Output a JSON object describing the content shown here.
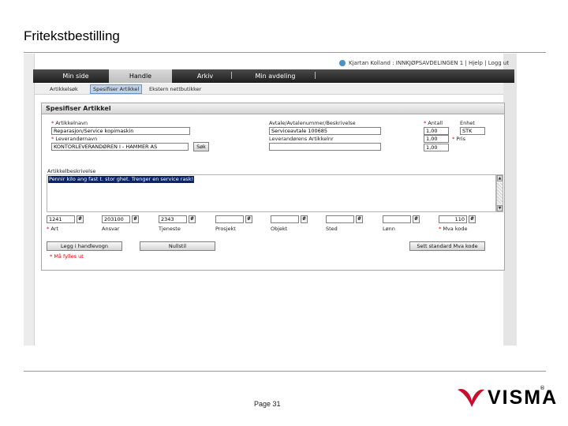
{
  "slide": {
    "title": "Fritekstbestilling",
    "page": "Page 31",
    "brand": "VISMA",
    "brand_mark": "®"
  },
  "app": {
    "userbar": "Kjartan Kolland : INNKJØPSAVDELINGEN 1 | Hjelp | Logg ut",
    "nav": {
      "tabs": [
        {
          "label": "Min side",
          "active": false
        },
        {
          "label": "Handle",
          "active": true
        },
        {
          "label": "Arkiv",
          "active": false
        },
        {
          "label": "Min avdeling",
          "active": false
        }
      ],
      "separator": "|"
    },
    "subnav": {
      "items": [
        {
          "label": "Artikkelsøk",
          "active": false
        },
        {
          "label": "Spesifiser Artikkel",
          "active": true
        },
        {
          "label": "Ekstern nettbutikker",
          "active": false
        }
      ]
    }
  },
  "form": {
    "title": "Spesifiser Artikkel",
    "required_mark": "*",
    "article_name": {
      "label": "Artikkelnavn",
      "value": "Reparasjon/Service kopimaskin"
    },
    "supplier_name": {
      "label": "Leverandørnavn",
      "value": "KONTORLEVERANDØREN I - HAMMER AS",
      "search_button": "Søk"
    },
    "agreement": {
      "label": "Avtale/Avtalenummer/Beskrivelse",
      "value": "Serviceavtale 100685"
    },
    "supplier_article_no": {
      "label": "Leverandørens Artikkelnr",
      "value": ""
    },
    "quantity": {
      "label": "Antall",
      "value": "1,00"
    },
    "unit": {
      "label": "Enhet",
      "value": "STK"
    },
    "price": {
      "label": "Pris",
      "value": "1,00"
    },
    "extra_field": {
      "value": "1,00"
    },
    "description": {
      "label": "Artikkelbeskrivelse",
      "value": "Pennir kilo ang fast t. stor ghet. Trenger en service rask!"
    },
    "dimensions": [
      {
        "label": "Art",
        "value": "1241",
        "required": true
      },
      {
        "label": "Ansvar",
        "value": "203100",
        "required": false
      },
      {
        "label": "Tjeneste",
        "value": "2343",
        "required": false
      },
      {
        "label": "Prosjekt",
        "value": "",
        "required": false
      },
      {
        "label": "Objekt",
        "value": "",
        "required": false
      },
      {
        "label": "Sted",
        "value": "",
        "required": false
      },
      {
        "label": "Lønn",
        "value": "",
        "required": false
      },
      {
        "label": "Mva kode",
        "value": "110",
        "required": true
      }
    ],
    "dim_pick_glyph": "#",
    "buttons": {
      "add_to_cart": "Legg i handlevogn",
      "reset": "Nullstil",
      "set_vat": "Sett standard Mva kode"
    },
    "required_note": "Må fylles ut"
  },
  "colors": {
    "nav_bg": "#2b2b2b",
    "active_subnav": "#bcd3ea",
    "required": "#dd0000",
    "selection": "#0a246a",
    "logo_red": "#c8102e"
  }
}
